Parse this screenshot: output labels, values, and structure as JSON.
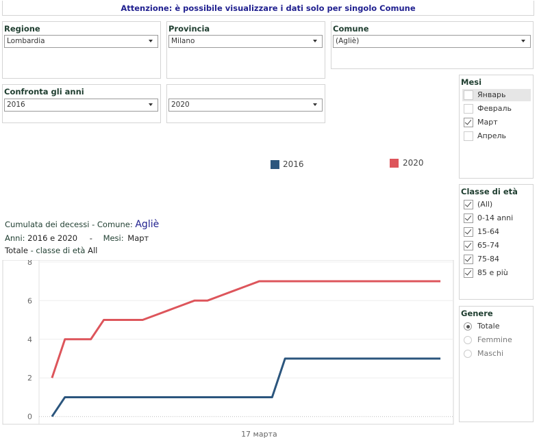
{
  "banner": "Attenzione: è possibile visualizzare i dati solo per singolo Comune",
  "filters": {
    "regione": {
      "label": "Regione",
      "value": "Lombardia"
    },
    "provincia": {
      "label": "Provincia",
      "value": "Milano"
    },
    "comune": {
      "label": "Comune",
      "value": "(Agliè)"
    },
    "anni": {
      "label": "Confronta gli anni",
      "value1": "2016",
      "value2": "2020"
    }
  },
  "mesi": {
    "title": "Mesi",
    "items": [
      {
        "label": "Январь",
        "checked": false
      },
      {
        "label": "Февраль",
        "checked": false
      },
      {
        "label": "Март",
        "checked": true
      },
      {
        "label": "Апрель",
        "checked": false
      }
    ]
  },
  "classe": {
    "title": "Classe di età",
    "items": [
      {
        "label": "(All)",
        "checked": true
      },
      {
        "label": "0-14 anni",
        "checked": true
      },
      {
        "label": "15-64",
        "checked": true
      },
      {
        "label": "65-74",
        "checked": true
      },
      {
        "label": "75-84",
        "checked": true
      },
      {
        "label": "85 e più",
        "checked": true
      }
    ]
  },
  "genere": {
    "title": "Genere",
    "items": [
      {
        "label": "Totale",
        "selected": true
      },
      {
        "label": "Femmine",
        "selected": false
      },
      {
        "label": "Maschi",
        "selected": false
      }
    ]
  },
  "header": {
    "line1_prefix": "Cumulata dei decessi -  Comune: ",
    "line1_comune": "Agliè",
    "line2_prefix": "Anni:",
    "line2_years": "2016 e 2020",
    "line2_sep": "-",
    "line2_mesi_label": "Mesi:",
    "line2_mesi": "Март",
    "line3_totale": "Totale",
    "line3_mid": " - classe di età ",
    "line3_all": "All"
  },
  "legend": [
    {
      "label": "2016",
      "color": "#2b557d"
    },
    {
      "label": "2020",
      "color": "#dd555b"
    }
  ],
  "chart_data": {
    "type": "line",
    "x": [
      1,
      2,
      3,
      4,
      5,
      6,
      7,
      8,
      9,
      10,
      11,
      12,
      13,
      14,
      15,
      16,
      17,
      18,
      19,
      20,
      21,
      22,
      23,
      24,
      25,
      26,
      27,
      28,
      29,
      30,
      31
    ],
    "series": [
      {
        "name": "2016",
        "color": "#2b557d",
        "values": [
          0,
          1,
          1,
          1,
          1,
          1,
          1,
          1,
          1,
          1,
          1,
          1,
          1,
          1,
          1,
          1,
          1,
          1,
          3,
          3,
          3,
          3,
          3,
          3,
          3,
          3,
          3,
          3,
          3,
          3,
          3
        ]
      },
      {
        "name": "2020",
        "color": "#dd555b",
        "values": [
          2,
          4,
          4,
          4,
          5,
          5,
          5,
          5,
          5.25,
          5.5,
          5.75,
          6,
          6,
          6.25,
          6.5,
          6.75,
          7,
          7,
          7,
          7,
          7,
          7,
          7,
          7,
          7,
          7,
          7,
          7,
          7,
          7,
          7
        ]
      }
    ],
    "yticks": [
      0,
      2,
      4,
      6,
      8
    ],
    "ylim": [
      -0.4,
      8.1
    ],
    "xtick_label": "17 марта",
    "xtick_at": 17,
    "xlim": [
      0,
      32
    ]
  }
}
